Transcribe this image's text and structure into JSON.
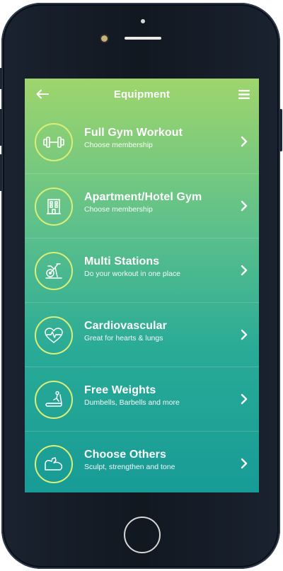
{
  "header": {
    "title": "Equipment",
    "back_icon": "arrow-left-icon",
    "menu_icon": "hamburger-menu-icon"
  },
  "items": [
    {
      "label": "Full Gym Workout",
      "subtitle": "Choose membership",
      "icon": "dumbbell-icon"
    },
    {
      "label": "Apartment/Hotel Gym",
      "subtitle": "Choose membership",
      "icon": "building-icon"
    },
    {
      "label": "Multi Stations",
      "subtitle": "Do your workout in one place",
      "icon": "exercise-bike-icon"
    },
    {
      "label": "Cardiovascular",
      "subtitle": "Great for hearts & lungs",
      "icon": "heart-pulse-icon"
    },
    {
      "label": "Free Weights",
      "subtitle": "Dumbells, Barbells and more",
      "icon": "treadmill-icon"
    },
    {
      "label": "Choose Others",
      "subtitle": "Sculpt, strengthen and tone",
      "icon": "flexed-arm-icon"
    }
  ],
  "colors": {
    "gradient_top": "#9fd56c",
    "gradient_bottom": "#179b96",
    "badge_ring": "#d9ef77",
    "phone_body": "#121820"
  }
}
